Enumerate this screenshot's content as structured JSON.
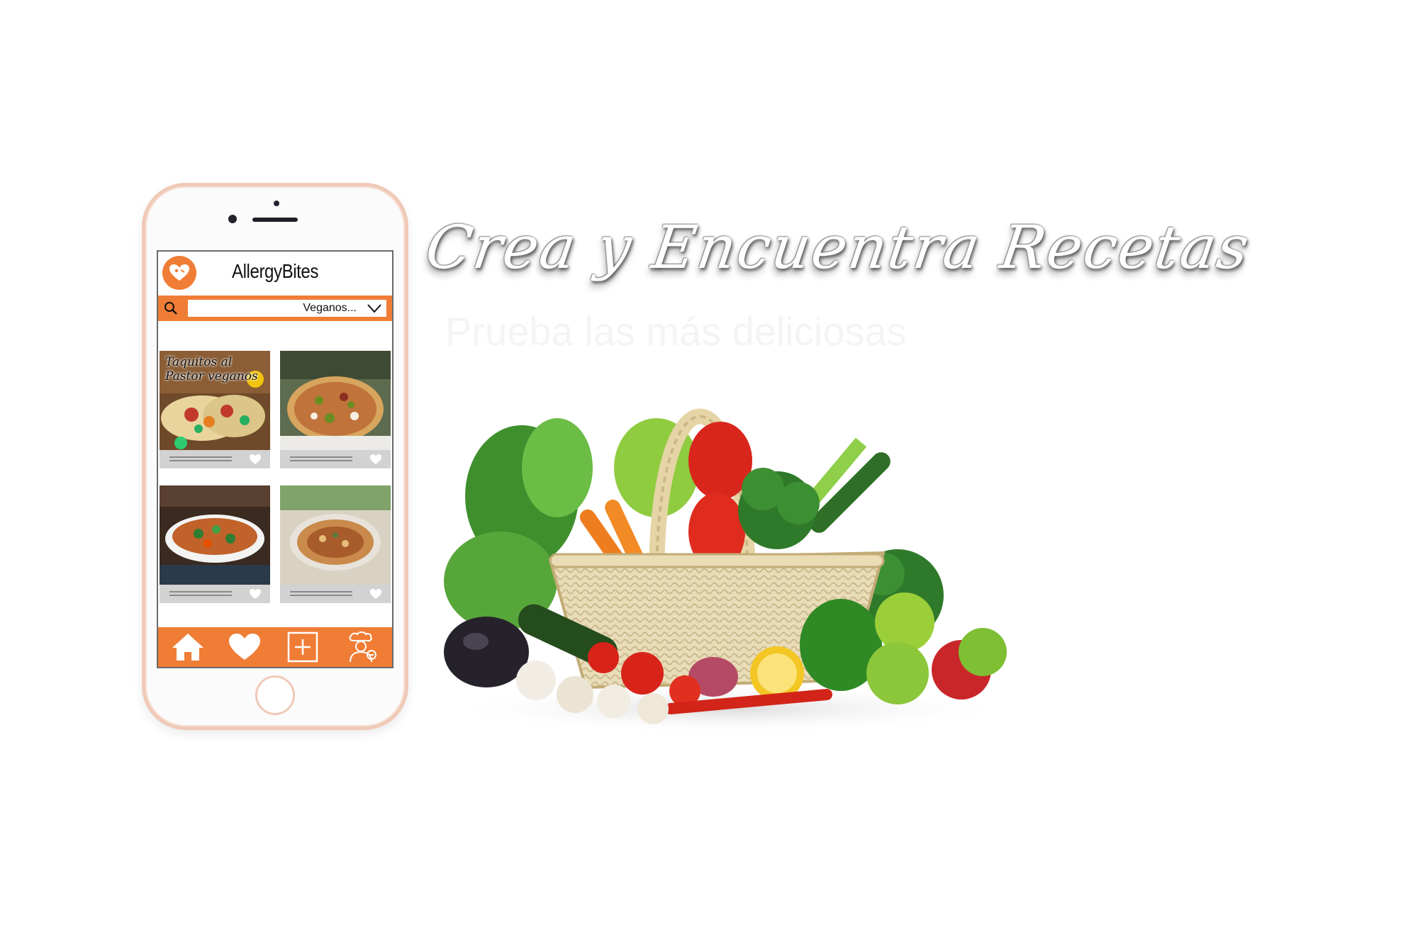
{
  "app": {
    "name": "AllergyBites",
    "search": {
      "value": "Veganos..."
    },
    "recipes": [
      {
        "overlay": "Taquitos al Pastor veganos",
        "favorite": false
      },
      {
        "overlay": "",
        "favorite": false
      },
      {
        "overlay": "",
        "favorite": false
      },
      {
        "overlay": "",
        "favorite": false
      }
    ],
    "tabs": [
      {
        "icon": "home-icon"
      },
      {
        "icon": "heart-icon"
      },
      {
        "icon": "plus-square-icon"
      },
      {
        "icon": "chef-profile-icon"
      }
    ],
    "colors": {
      "accent": "#f07d35",
      "card_footer": "#d2d2d2",
      "phone_frame": "#f0c9b7"
    }
  },
  "hero": {
    "headline": "Crea y Encuentra Recetas",
    "subhead": "Prueba las más deliciosas"
  }
}
